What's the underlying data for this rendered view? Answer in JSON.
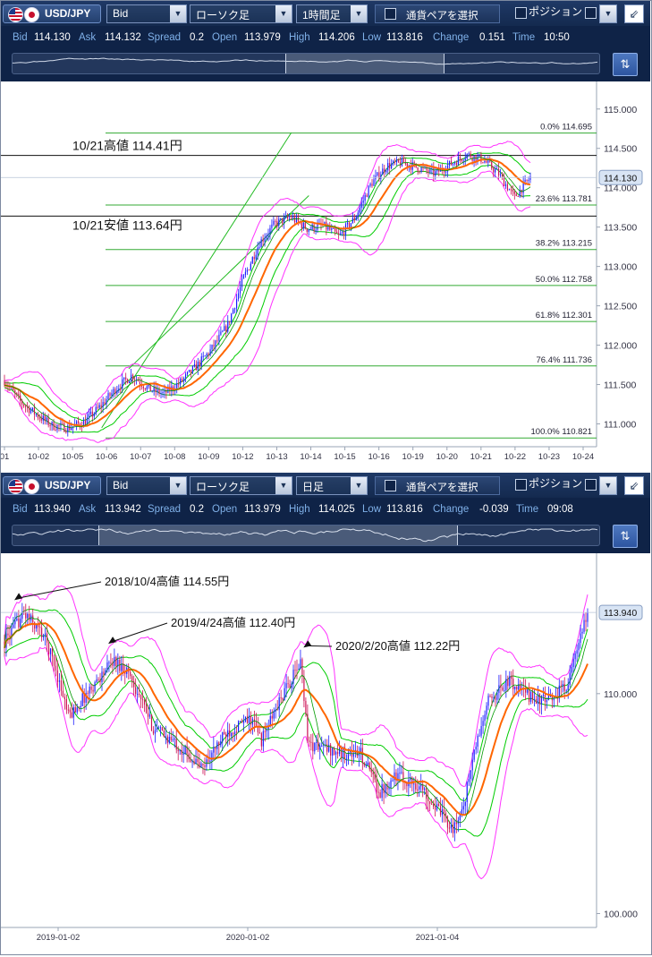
{
  "panels": [
    {
      "toolbar": {
        "pair": "USD/JPY",
        "price_type": "Bid",
        "chart_style": "ローソク足",
        "timeframe": "1時間足",
        "select_pair": "通貨ペアを選択",
        "position": "ポジション"
      },
      "info": {
        "bid_label": "Bid",
        "bid": "114.130",
        "ask_label": "Ask",
        "ask": "114.132",
        "spread_label": "Spread",
        "spread": "0.2",
        "open_label": "Open",
        "open": "113.979",
        "high_label": "High",
        "high": "114.206",
        "low_label": "Low",
        "low": "113.816",
        "change_label": "Change",
        "change": "0.151",
        "time_label": "Time",
        "time": "10:50"
      },
      "current_price": "114.130",
      "annotations": [
        "10/21高値 114.41円",
        "10/21安値 113.64円"
      ]
    },
    {
      "toolbar": {
        "pair": "USD/JPY",
        "price_type": "Bid",
        "chart_style": "ローソク足",
        "timeframe": "日足",
        "select_pair": "通貨ペアを選択",
        "position": "ポジション"
      },
      "info": {
        "bid_label": "Bid",
        "bid": "113.940",
        "ask_label": "Ask",
        "ask": "113.942",
        "spread_label": "Spread",
        "spread": "0.2",
        "open_label": "Open",
        "open": "113.979",
        "high_label": "High",
        "high": "114.025",
        "low_label": "Low",
        "low": "113.816",
        "change_label": "Change",
        "change": "-0.039",
        "time_label": "Time",
        "time": "09:08"
      },
      "current_price": "113.940",
      "annotations": [
        "2018/10/4高値 114.55円",
        "2019/4/24高値 112.40円",
        "2020/2/20高値 112.22円"
      ]
    }
  ],
  "colors": {
    "candle_up": "#1a1aff",
    "candle_down": "#cc1155",
    "ma_fast": "#ff6600",
    "bands_inner": "#00cc00",
    "bands_outer": "#ff33ff",
    "fib_line": "#33aa33"
  },
  "chart_data": [
    {
      "type": "candlestick",
      "timeframe": "1時間足",
      "x_ticks": [
        "01",
        "10-02",
        "10-05",
        "10-06",
        "10-07",
        "10-08",
        "10-09",
        "10-12",
        "10-13",
        "10-14",
        "10-15",
        "10-16",
        "10-19",
        "10-20",
        "10-21",
        "10-22",
        "10-23",
        "10-24"
      ],
      "y_ticks": [
        "115.000",
        "114.500",
        "114.000",
        "113.500",
        "113.000",
        "112.500",
        "112.000",
        "111.500",
        "111.000"
      ],
      "ylim": [
        110.71,
        115.35
      ],
      "close_path": [
        [
          0,
          111.55
        ],
        [
          0.5,
          111.28
        ],
        [
          1,
          111.12
        ],
        [
          1.5,
          110.98
        ],
        [
          2,
          110.95
        ],
        [
          2.5,
          111.02
        ],
        [
          3,
          111.22
        ],
        [
          3.5,
          111.45
        ],
        [
          4,
          111.62
        ],
        [
          4.5,
          111.45
        ],
        [
          5,
          111.38
        ],
        [
          5.5,
          111.52
        ],
        [
          6,
          111.72
        ],
        [
          6.5,
          111.95
        ],
        [
          7,
          112.25
        ],
        [
          7.5,
          112.85
        ],
        [
          8,
          113.3
        ],
        [
          8.5,
          113.55
        ],
        [
          9,
          113.62
        ],
        [
          9.5,
          113.48
        ],
        [
          10,
          113.52
        ],
        [
          10.5,
          113.38
        ],
        [
          11,
          113.62
        ],
        [
          11.5,
          114.05
        ],
        [
          12,
          114.28
        ],
        [
          12.5,
          114.32
        ],
        [
          13,
          114.25
        ],
        [
          13.5,
          114.18
        ],
        [
          14,
          114.3
        ],
        [
          14.5,
          114.42
        ],
        [
          15,
          114.36
        ],
        [
          15.5,
          114.18
        ],
        [
          16,
          113.88
        ],
        [
          16.5,
          114.13
        ]
      ],
      "fibonacci": [
        {
          "label": "0.0%",
          "price": 114.695
        },
        {
          "label": "23.6%",
          "price": 113.781
        },
        {
          "label": "38.2%",
          "price": 113.215
        },
        {
          "label": "50.0%",
          "price": 112.758
        },
        {
          "label": "61.8%",
          "price": 112.301
        },
        {
          "label": "76.4%",
          "price": 111.736
        },
        {
          "label": "100.0%",
          "price": 110.821
        }
      ],
      "hlines": [
        114.41,
        113.64
      ],
      "last": 114.13,
      "trendlines": [
        [
          [
            3.05,
            110.95
          ],
          [
            9.0,
            114.7
          ]
        ],
        [
          [
            3.9,
            111.7
          ],
          [
            9.55,
            113.9
          ]
        ]
      ]
    },
    {
      "type": "candlestick",
      "timeframe": "日足",
      "x_ticks": [
        "2019-01-02",
        "2020-01-02",
        "2021-01-04"
      ],
      "y_ticks": [
        "110.000",
        "100.000"
      ],
      "log_scale": true,
      "ylim": [
        99.4,
        116.9
      ],
      "close_path": [
        [
          0,
          112.5
        ],
        [
          0.04,
          113.9
        ],
        [
          0.08,
          112.8
        ],
        [
          0.1,
          111.5
        ],
        [
          0.13,
          108.9
        ],
        [
          0.17,
          110.1
        ],
        [
          0.22,
          111.6
        ],
        [
          0.25,
          111.1
        ],
        [
          0.3,
          108.4
        ],
        [
          0.35,
          107.6
        ],
        [
          0.4,
          106.5
        ],
        [
          0.45,
          108.2
        ],
        [
          0.5,
          108.8
        ],
        [
          0.52,
          107.8
        ],
        [
          0.56,
          109.8
        ],
        [
          0.6,
          111.5
        ],
        [
          0.615,
          107.6
        ],
        [
          0.64,
          107.5
        ],
        [
          0.68,
          107.2
        ],
        [
          0.72,
          107.2
        ],
        [
          0.76,
          105.4
        ],
        [
          0.79,
          106.2
        ],
        [
          0.84,
          105.7
        ],
        [
          0.88,
          104.5
        ],
        [
          0.91,
          103.7
        ],
        [
          0.93,
          104.9
        ],
        [
          0.95,
          107.2
        ],
        [
          0.98,
          109.7
        ],
        [
          1.02,
          110.6
        ],
        [
          1.06,
          109.9
        ],
        [
          1.1,
          109.6
        ],
        [
          1.14,
          110.5
        ],
        [
          1.18,
          113.9
        ]
      ],
      "last": 113.94,
      "highs_marked": [
        {
          "label": "2018/10/4高値 114.55円",
          "price": 114.55
        },
        {
          "label": "2019/4/24高値 112.40円",
          "price": 112.4
        },
        {
          "label": "2020/2/20高値 112.22円",
          "price": 112.22
        }
      ]
    }
  ]
}
